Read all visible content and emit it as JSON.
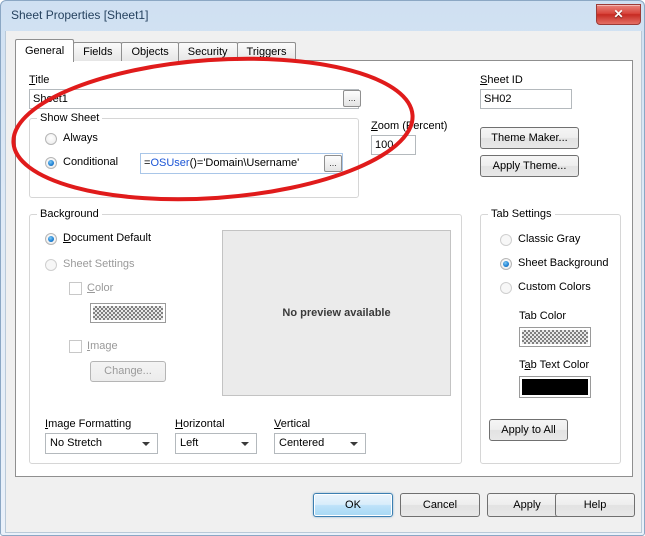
{
  "window": {
    "title": "Sheet Properties [Sheet1]",
    "close_icon": "close-icon",
    "close_label": "✕"
  },
  "tabs": [
    {
      "label": "General",
      "active": true
    },
    {
      "label": "Fields",
      "active": false
    },
    {
      "label": "Objects",
      "active": false
    },
    {
      "label": "Security",
      "active": false
    },
    {
      "label": "Triggers",
      "active": false
    }
  ],
  "general": {
    "title_label": "Title",
    "title_value": "Sheet1",
    "title_browse_label": "...",
    "show_sheet": {
      "group_label": "Show Sheet",
      "always_label": "Always",
      "always_selected": false,
      "conditional_label": "Conditional",
      "conditional_selected": true,
      "expression_prefix": "=",
      "expression_function": "OSUser",
      "expression_suffix": "()='Domain\\Username'",
      "expression_full": "=OSUser()='Domain\\Username'",
      "expression_browse_label": "..."
    },
    "zoom": {
      "label": "Zoom (Percent)",
      "value": "100"
    },
    "sheet_id": {
      "label": "Sheet ID",
      "value": "SH02"
    },
    "theme_maker_label": "Theme Maker...",
    "apply_theme_label": "Apply Theme...",
    "background": {
      "group_label": "Background",
      "document_default_label": "Document Default",
      "document_default_selected": true,
      "sheet_settings_label": "Sheet Settings",
      "sheet_settings_selected": false,
      "color_label": "Color",
      "color_checked": false,
      "color_swatch": "checkered",
      "image_label": "Image",
      "image_checked": false,
      "change_label": "Change...",
      "preview_text": "No preview available",
      "image_formatting_label": "Image Formatting",
      "image_formatting_value": "No Stretch",
      "horizontal_label": "Horizontal",
      "horizontal_value": "Left",
      "vertical_label": "Vertical",
      "vertical_value": "Centered"
    },
    "tab_settings": {
      "group_label": "Tab Settings",
      "classic_gray_label": "Classic Gray",
      "classic_gray_selected": false,
      "sheet_background_label": "Sheet Background",
      "sheet_background_selected": true,
      "custom_colors_label": "Custom Colors",
      "custom_colors_selected": false,
      "tab_color_label": "Tab Color",
      "tab_color_swatch": "checkered",
      "tab_text_color_label": "Tab Text Color",
      "tab_text_color_value": "#000000",
      "apply_to_all_label": "Apply to All"
    }
  },
  "footer": {
    "ok_label": "OK",
    "cancel_label": "Cancel",
    "apply_label": "Apply",
    "help_label": "Help"
  },
  "annotation": {
    "shape": "ellipse",
    "color": "#e01b1b",
    "purpose": "highlights Title field and Show Sheet conditional expression"
  },
  "colors": {
    "accent": "#1c7fd4",
    "annotation_red": "#e01b1b",
    "title_text": "#26425f",
    "expression_blue": "#1b55d6"
  }
}
